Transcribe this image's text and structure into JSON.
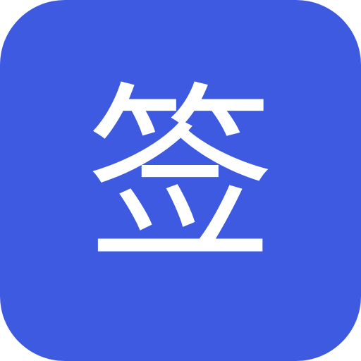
{
  "icon": {
    "glyph": "签",
    "background_color": "#3d5ae0",
    "glyph_color": "#ffffff"
  }
}
